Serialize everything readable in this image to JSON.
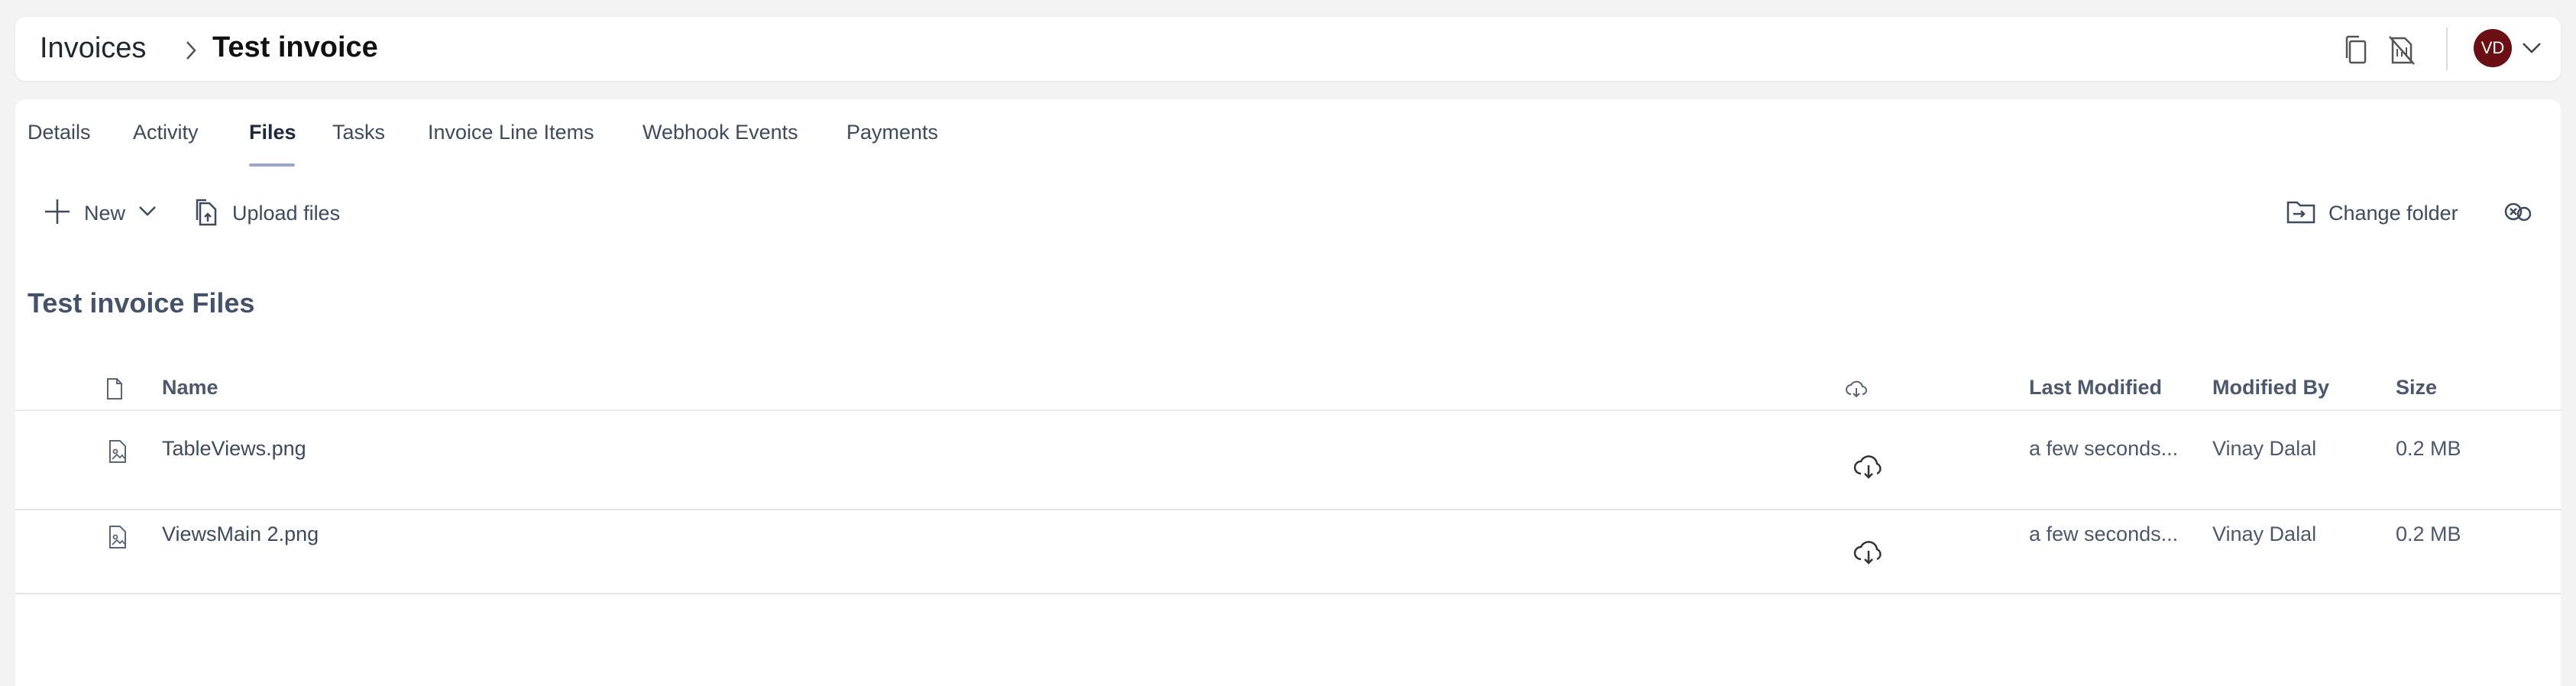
{
  "header": {
    "breadcrumb_root": "Invoices",
    "breadcrumb_current": "Test invoice",
    "avatar_initials": "VD",
    "avatar_color": "#6b0f14"
  },
  "tabs": [
    {
      "label": "Details"
    },
    {
      "label": "Activity"
    },
    {
      "label": "Files",
      "active": true
    },
    {
      "label": "Tasks"
    },
    {
      "label": "Invoice Line Items"
    },
    {
      "label": "Webhook Events"
    },
    {
      "label": "Payments"
    }
  ],
  "toolbar": {
    "new_label": "New",
    "upload_label": "Upload files",
    "change_folder_label": "Change folder"
  },
  "section_title": "Test invoice Files",
  "table": {
    "columns": {
      "name": "Name",
      "last_modified": "Last Modified",
      "modified_by": "Modified By",
      "size": "Size"
    },
    "rows": [
      {
        "name": "TableViews.png",
        "last_modified": "a few seconds...",
        "modified_by": "Vinay Dalal",
        "size": "0.2 MB"
      },
      {
        "name": "ViewsMain 2.png",
        "last_modified": "a few seconds...",
        "modified_by": "Vinay Dalal",
        "size": "0.2 MB"
      }
    ]
  },
  "icons": {
    "file": "file-icon",
    "image_file": "image-file-icon",
    "cloud_download": "cloud-download-icon",
    "copy": "copy-icon",
    "no_pdf": "file-slash-icon"
  }
}
